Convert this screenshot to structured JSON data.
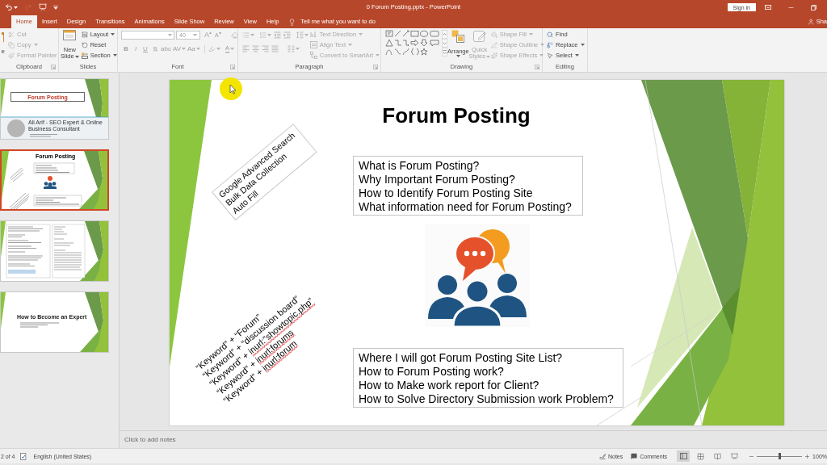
{
  "title_bar": {
    "quick_access": [
      {
        "kind": "undo",
        "disabled": false
      },
      {
        "kind": "redo",
        "disabled": true
      },
      {
        "kind": "present",
        "disabled": false
      },
      {
        "kind": "customize",
        "disabled": false
      }
    ],
    "title": "0 Forum Posting.pptx - PowerPoint",
    "sign_in": "Sign in"
  },
  "tabs": [
    {
      "label": "Home",
      "selected": true
    },
    {
      "label": "Insert",
      "selected": false
    },
    {
      "label": "Design",
      "selected": false
    },
    {
      "label": "Transitions",
      "selected": false
    },
    {
      "label": "Animations",
      "selected": false
    },
    {
      "label": "Slide Show",
      "selected": false
    },
    {
      "label": "Review",
      "selected": false
    },
    {
      "label": "View",
      "selected": false
    },
    {
      "label": "Help",
      "selected": false
    }
  ],
  "tell_me": {
    "placeholder": "Tell me what you want to do"
  },
  "share": "Sha",
  "ribbon": {
    "clipboard": {
      "label": "Clipboard",
      "paste": "e",
      "items": [
        {
          "label": "Cut",
          "disabled": true,
          "dropdown": false
        },
        {
          "label": "Copy",
          "disabled": true,
          "dropdown": true
        },
        {
          "label": "Format Painter",
          "disabled": true,
          "dropdown": false
        }
      ]
    },
    "slides": {
      "label": "Slides",
      "new_slide": [
        "New",
        "Slide"
      ],
      "items": [
        {
          "label": "Layout",
          "disabled": false,
          "dropdown": true
        },
        {
          "label": "Reset",
          "disabled": false,
          "dropdown": false
        },
        {
          "label": "Section",
          "disabled": false,
          "dropdown": true
        }
      ]
    },
    "font": {
      "label": "Font",
      "disabled": true,
      "font_size": "40",
      "grow": "A",
      "shrink": "A",
      "styles": [
        {
          "label": "B",
          "dropdown": false
        },
        {
          "label": "I",
          "dropdown": false
        },
        {
          "label": "U",
          "dropdown": false
        },
        {
          "label": "S",
          "dropdown": false
        },
        {
          "label": "abc",
          "dropdown": false
        },
        {
          "label": "AV",
          "dropdown": true
        },
        {
          "label": "Aa",
          "dropdown": true
        }
      ],
      "font_color": "A"
    },
    "paragraph": {
      "label": "Paragraph",
      "disabled": true,
      "items": [
        {
          "label": "Text Direction",
          "disabled": true,
          "dropdown": true
        },
        {
          "label": "Align Text",
          "disabled": true,
          "dropdown": true
        },
        {
          "label": "Convert to SmartArt",
          "disabled": true,
          "dropdown": true
        }
      ]
    },
    "drawing": {
      "label": "Drawing",
      "arrange": "Arrange",
      "quick_styles": {
        "lines": [
          "Quick",
          "Styles"
        ],
        "disabled": true
      },
      "items": [
        {
          "label": "Shape Fill",
          "disabled": true,
          "dropdown": true
        },
        {
          "label": "Shape Outline",
          "disabled": true,
          "dropdown": true
        },
        {
          "label": "Shape Effects",
          "disabled": true,
          "dropdown": true
        }
      ]
    },
    "editing": {
      "label": "Editing",
      "items": [
        {
          "label": "Find",
          "disabled": false,
          "dropdown": false
        },
        {
          "label": "Replace",
          "disabled": false,
          "dropdown": true
        },
        {
          "label": "Select",
          "disabled": false,
          "dropdown": true
        }
      ]
    }
  },
  "slides_pane": {
    "thumbnails": [
      {
        "kind": "title",
        "selected": false,
        "title": "Forum Posting",
        "subtitle": "Ali Arif - SEO Expert & Online Business Consultant"
      },
      {
        "kind": "agenda",
        "selected": true,
        "title": "Forum Posting"
      },
      {
        "kind": "text",
        "selected": false
      },
      {
        "kind": "list",
        "selected": false,
        "title": "How to Become an Expert"
      }
    ]
  },
  "slide": {
    "title": "Forum Posting",
    "rotated_box": [
      "Google Advanced Search",
      "Bulk Data Collection",
      "Auto Fill"
    ],
    "top_questions": [
      "What is Forum Posting?",
      "Why Important Forum Posting?",
      "How to Identify Forum Posting Site",
      "What information need for Forum Posting?"
    ],
    "keyword_lines": [
      {
        "text": "“Keyword” + “Forum”",
        "spelling_error": false
      },
      {
        "text": "“Keyword” + “discussion board”",
        "spelling_error": false
      },
      {
        "text": "“Keyword” + inurl:”showtopic.php”",
        "spelling_error": true
      },
      {
        "text": "“Keyword” + inurl:forums",
        "spelling_error": true
      },
      {
        "text": "“Keyword” + inurl:forum",
        "spelling_error": true
      }
    ],
    "bottom_questions": [
      "Where I will got Forum Posting Site List?",
      "How to Forum Posting work?",
      "How to Make work report for Client?",
      "How to Solve Directory Submission work Problem?"
    ]
  },
  "notes": {
    "placeholder": "Click to add notes"
  },
  "status_bar": {
    "slide_counter": "2 of 4",
    "language": "English (United States)",
    "notes": "Notes",
    "comments": "Comments",
    "views": [
      {
        "selected": true
      },
      {
        "selected": false
      },
      {
        "selected": false
      },
      {
        "selected": false
      }
    ],
    "zoom": {
      "level": 0.5,
      "reading": "100%"
    }
  }
}
